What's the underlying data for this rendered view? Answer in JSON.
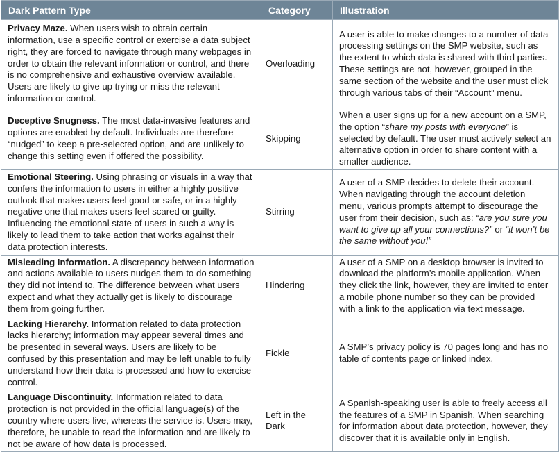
{
  "headers": [
    "Dark Pattern Type",
    "Category",
    "Illustration"
  ],
  "rows": [
    {
      "name": "Privacy Maze.",
      "description": " When users wish to obtain certain information, use a specific control or exercise a data subject right, they are forced to navigate through many webpages in order to obtain the relevant information or control, and there is no comprehensive and exhaustive overview available. Users are likely to give up trying or miss the relevant information or control.",
      "category": "Overloading",
      "illustration": "A user is able to make changes to a number of data processing settings on the SMP website, such as the extent to which data is shared with third parties. These settings are not, however, grouped in the same section of the website and the user must click through various tabs of their “Account” menu."
    },
    {
      "name": "Deceptive Snugness.",
      "description": " The most data-invasive features and options are enabled by default. Individuals are therefore “nudged” to keep a pre-selected option, and are unlikely to change this setting even if offered the possibility.",
      "category": "Skipping",
      "illustration_pre": "When a user signs up for a new account on a SMP, the option “",
      "illustration_em": "share my posts with everyone",
      "illustration_post": "” is selected by default. The user must actively select an alternative option in order to share content with a smaller audience."
    },
    {
      "name": "Emotional Steering.",
      "description": " Using phrasing or visuals in a way that confers the information to users in either a highly positive outlook that makes users feel good or safe, or in a highly negative one that makes users feel scared or guilty. Influencing the emotional state of users in such a way is likely to lead them to take action that works against their data protection interests.",
      "category": "Stirring",
      "illustration_pre": "A user of a SMP decides to delete their account. When navigating through the account deletion menu, various prompts attempt to discourage the user from their decision, such as: ",
      "illustration_em": "“are you sure you want to give up all your connections?”",
      "illustration_mid": " or ",
      "illustration_em2": "“it won’t be the same without you!”"
    },
    {
      "name": "Misleading Information.",
      "description": " A discrepancy between information and actions available to users nudges them to do something they did not intend to. The difference between what users expect and what they actually get is likely to discourage them from going further.",
      "category": "Hindering",
      "illustration": "A user of a SMP on a desktop browser is invited to download the platform’s mobile application. When they click the link, however, they are invited to enter a mobile phone number so they can be provided with a link to the application via text message."
    },
    {
      "name": "Lacking Hierarchy.",
      "description": " Information related to data protection lacks hierarchy; information may appear several times and be presented in several ways. Users are likely to be confused by this presentation and may be left unable to fully understand how their data is processed and how to exercise control.",
      "category": "Fickle",
      "illustration": "A SMP’s privacy policy is 70 pages long and has no table of contents page or linked index."
    },
    {
      "name": "Language Discontinuity.",
      "description": " Information related to data protection is not provided in the official language(s) of the country where users live, whereas the service is. Users may, therefore, be unable to read the information and are likely to not be aware of how data is processed.",
      "category": "Left in the Dark",
      "illustration": "A Spanish-speaking user is able to freely access all the features of a SMP in Spanish. When searching for information about data protection, however, they discover that it is available only in English."
    }
  ]
}
